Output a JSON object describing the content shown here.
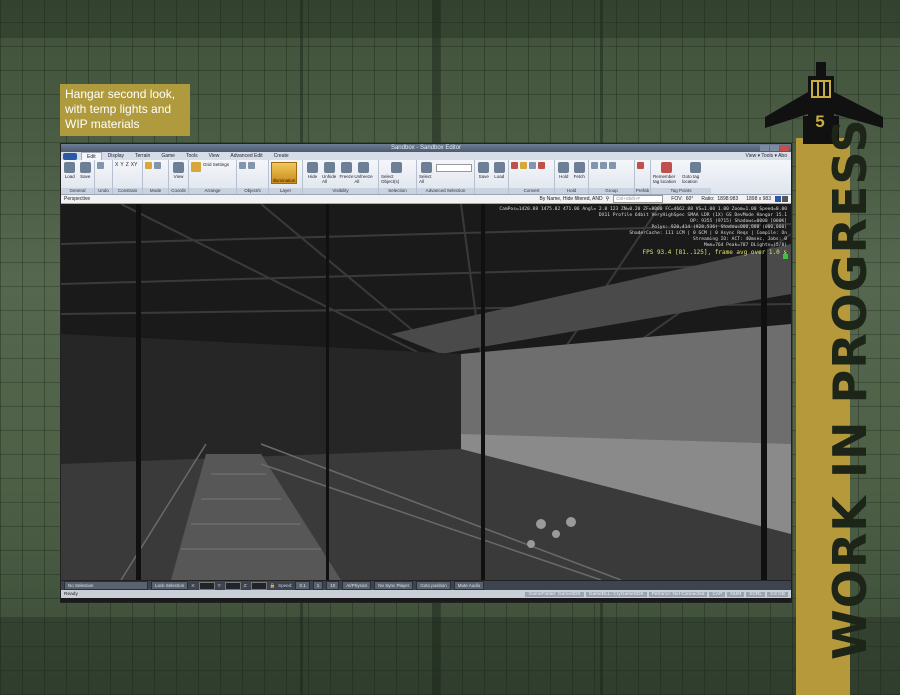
{
  "caption": {
    "line1": "Hangar second look,",
    "line2": "with temp lights and",
    "line3": "WIP materials"
  },
  "decoration": {
    "banner_text": "WORK IN PROGRESS",
    "number": "5",
    "accent_color": "#b6993a"
  },
  "window": {
    "title": "Sandbox - Sandbox Editor",
    "tabs": [
      "Edit",
      "Display",
      "Terrain",
      "Game",
      "Tools",
      "View",
      "Advanced Edit",
      "Create"
    ],
    "active_tab": "Edit",
    "right_menu": "View ▾  Tools ▾  Abo"
  },
  "ribbon": {
    "groups": [
      {
        "label": "General",
        "buttons": [
          "Load",
          "Save"
        ]
      },
      {
        "label": "Undo",
        "buttons": []
      },
      {
        "label": "Constrain",
        "buttons": [
          "X",
          "Y",
          "Z",
          "XY"
        ]
      },
      {
        "label": "Mode",
        "buttons": []
      },
      {
        "label": "Coords",
        "buttons": [
          "View"
        ]
      },
      {
        "label": "Arrange",
        "buttons": [
          "Grid Settings"
        ]
      },
      {
        "label": "Object/s",
        "buttons": []
      },
      {
        "label": "Layer",
        "buttons": [
          "Illumination"
        ]
      },
      {
        "label": "Visibility",
        "buttons": [
          "Hide",
          "Unhide All",
          "Freeze",
          "Unfreeze All"
        ]
      },
      {
        "label": "Selection",
        "buttons": [
          "Select Object(s)"
        ]
      },
      {
        "label": "Advanced Selection",
        "buttons": [
          "Select All"
        ]
      },
      {
        "label": "",
        "buttons": [
          "Save",
          "Load"
        ]
      },
      {
        "label": "Convert",
        "buttons": []
      },
      {
        "label": "Hold",
        "buttons": [
          "Hold",
          "Fetch"
        ]
      },
      {
        "label": "Group",
        "buttons": []
      },
      {
        "label": "Prefab",
        "buttons": []
      },
      {
        "label": "Tag Points",
        "buttons": [
          "Remember tag location",
          "Goto tag location"
        ]
      }
    ]
  },
  "addressbar": {
    "view": "Perspective",
    "filter": "By Name, Hide filtered, AND",
    "search_placeholder": "Ctrl+Shift+F",
    "fov_label": "FOV:",
    "fov": "60°",
    "ratio_label": "Ratio:",
    "ratio": "1898:983",
    "resolution": "1898 x 983"
  },
  "stats": {
    "lines": [
      "CamPos=1420.88 1475.82 471.06 Angl=  2.0  123 ZN=0.20 ZF=8000 FC=4662.88 VS=1.00 1.00 Zoom=1.00 Speed=0.00",
      "DX11 Profile 64bit VeryHighSpec SMAA LDR (1X) GS DevMode Hangar 15.1",
      "DP: 9355 (9715) Shadows=0000 [000K]",
      "Polys: 920,414 (928,536) Shadow=000,000 (000,000)",
      "ShaderCache: 111 LCM | 0 GCM | 0 Async Reqs | Compile: On",
      "Streaming IO: ACT: 40msec, Jobs: 0",
      "Mem=764 Peak=787 DLights=(5/8)"
    ],
    "fps": "FPS 93.4 [81..125], frame avg over 1.0 s"
  },
  "statusbar": {
    "selection": "No Selection",
    "lock": "Lock Selection",
    "x_label": "X:",
    "y_label": "Y:",
    "z_label": "Z:",
    "speed_label": "Speed:",
    "speed_value": "0.1",
    "speed_options": [
      "1",
      "10"
    ],
    "buttons": [
      "AI/Physics",
      "No Sync Player",
      "Goto position",
      "Mute Audio"
    ]
  },
  "readybar": {
    "text": "Ready",
    "right": [
      "GameFolder: GameSDK",
      "GameDLL: CryGameSDK",
      "Perforce: Not Connected",
      "CAP",
      "NUM",
      "SCRL",
      "3.8 GB"
    ]
  }
}
